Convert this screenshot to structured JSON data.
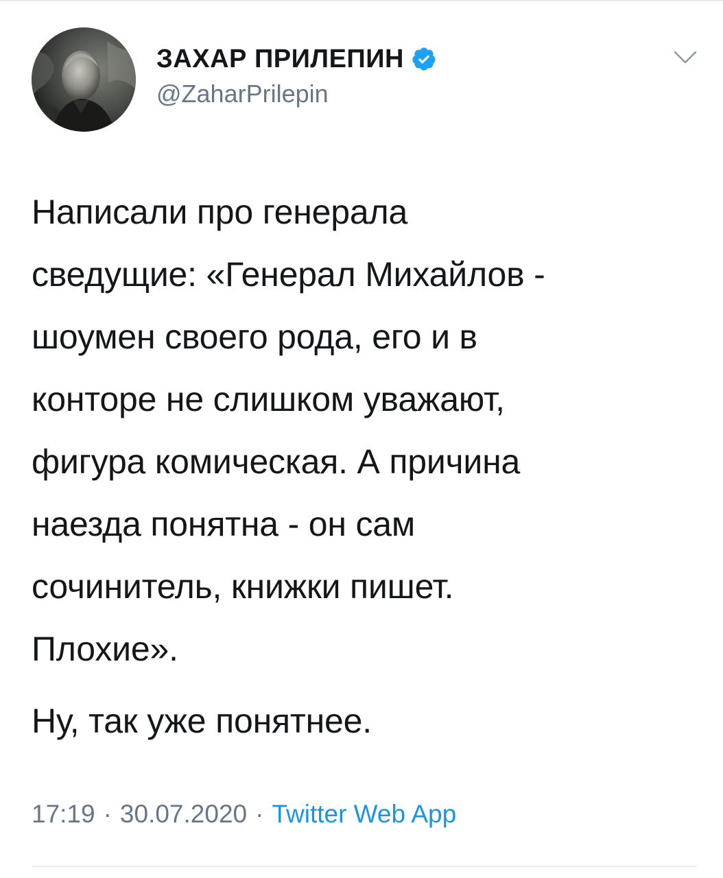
{
  "tweet": {
    "author": {
      "display_name": "ЗАХАР ПРИЛЕПИН",
      "handle": "@ZaharPrilepin",
      "verified": true,
      "avatar_icon": "profile-photo"
    },
    "text_paragraph_1": "Написали про генерала\nсведущие: «Генерал Михайлов -\nшоумен своего рода, его и в\nконторе не слишком уважают,\nфигура комическая. А причина\nнаезда понятна - он сам\nсочинитель, книжки пишет.\nПлохие».",
    "text_paragraph_2": "Ну, так уже понятнее.",
    "time": "17:19",
    "separator": "·",
    "date": "30.07.2020",
    "source": "Twitter Web App",
    "menu_icon": "chevron-down-icon"
  },
  "colors": {
    "text": "#14171a",
    "secondary": "#657786",
    "accent": "#1b95e0",
    "divider": "#e6ecf0"
  }
}
